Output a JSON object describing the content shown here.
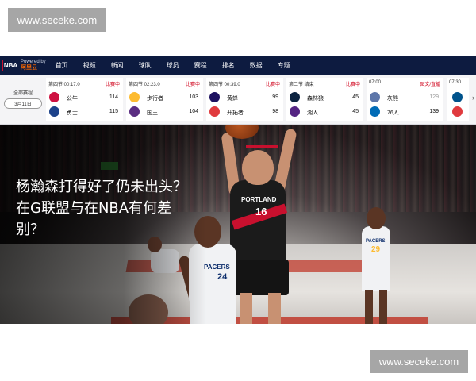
{
  "watermarks": {
    "top": "www.seceke.com",
    "bottom": "www.seceke.com"
  },
  "nav": {
    "logo_text": "NBA",
    "powered_by": "Powered by",
    "partner": "阿里云",
    "items": [
      "首页",
      "视频",
      "新闻",
      "球队",
      "球员",
      "赛程",
      "排名",
      "数据",
      "专题"
    ]
  },
  "scorebar": {
    "schedule_label": "全部赛程",
    "date": "3月11日",
    "games": [
      {
        "period": "第四节 00:17.0",
        "status": "比赛中",
        "teams": [
          {
            "name": "公牛",
            "score": "114",
            "color": "#ce1141"
          },
          {
            "name": "勇士",
            "score": "115",
            "color": "#1d428a"
          }
        ]
      },
      {
        "period": "第四节 02:23.0",
        "status": "比赛中",
        "teams": [
          {
            "name": "步行者",
            "score": "103",
            "color": "#fdbb30"
          },
          {
            "name": "国王",
            "score": "104",
            "color": "#5a2d81"
          }
        ]
      },
      {
        "period": "第四节 00:39.0",
        "status": "比赛中",
        "teams": [
          {
            "name": "黄蜂",
            "score": "99",
            "color": "#1d1160"
          },
          {
            "name": "开拓者",
            "score": "98",
            "color": "#e03a3e"
          }
        ]
      },
      {
        "period": "第二节 结束",
        "status": "比赛中",
        "teams": [
          {
            "name": "森林狼",
            "score": "45",
            "color": "#0c2340"
          },
          {
            "name": "湖人",
            "score": "45",
            "color": "#552583"
          }
        ]
      },
      {
        "period": "07:00",
        "status": "图文/直播",
        "teams": [
          {
            "name": "灰熊",
            "score": "129",
            "color": "#5d76a9"
          },
          {
            "name": "76人",
            "score": "139",
            "color": "#006bb6"
          }
        ]
      },
      {
        "period": "07:30",
        "status": "",
        "teams": [
          {
            "name": "",
            "score": "",
            "color": "#00538c"
          },
          {
            "name": "",
            "score": "",
            "color": "#e03a3e"
          }
        ]
      }
    ],
    "next_arrow": "›"
  },
  "hero": {
    "headline": "杨瀚森打得好了仍未出头？在G联盟与在NBA有何差别？",
    "jersey_main": {
      "team": "PORTLAND",
      "number": "16"
    },
    "jersey_left": {
      "team": "PACERS",
      "number": "24"
    },
    "jersey_right": {
      "team": "PACERS",
      "number": "29"
    }
  }
}
